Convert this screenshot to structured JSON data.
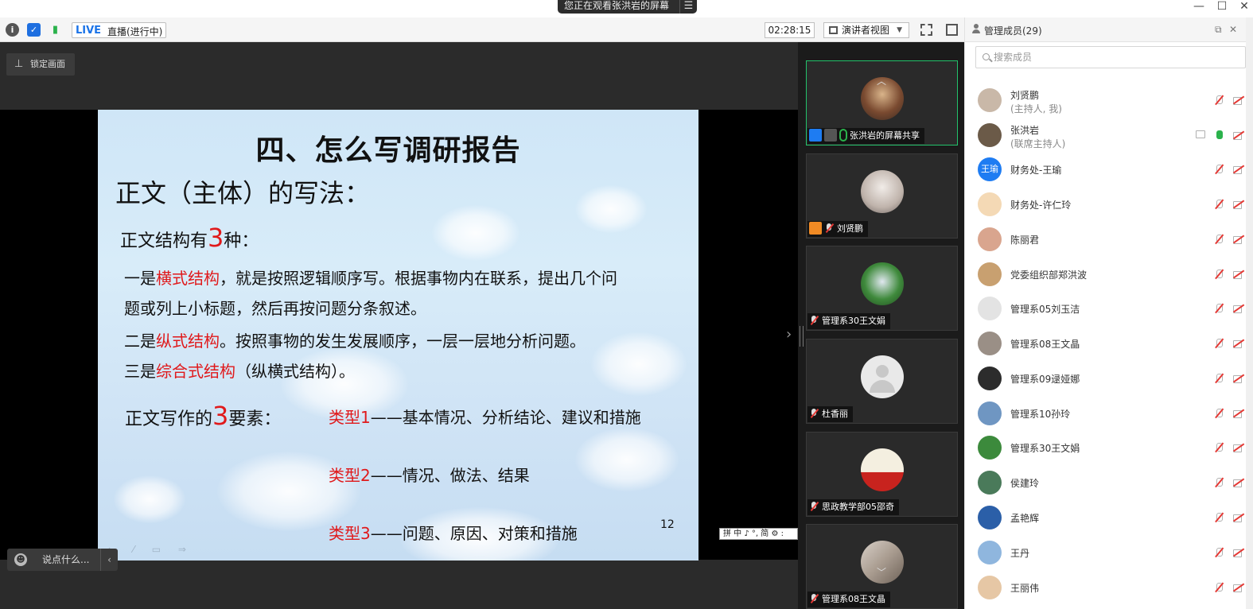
{
  "window": {
    "sharing_banner": "您正在观看张洪岩的屏幕",
    "menu_glyph": "☰",
    "minimize": "—",
    "maximize": "☐",
    "close": "✕"
  },
  "toolbar": {
    "live_label": "LIVE",
    "live_status": "直播(进行中)",
    "timer": "02:28:15",
    "view_mode": "演讲者视图",
    "info_icon": "info-icon",
    "shield_icon": "shield-icon",
    "signal_icon": "signal-icon"
  },
  "stage": {
    "lock_button": "锁定画面",
    "chat_placeholder": "说点什么...",
    "ime_text": "拼 中 ♪ °, 简 ⚙ :"
  },
  "slide": {
    "title": "四、怎么写调研报告",
    "heading": "正文（主体）的写法：",
    "structures_prefix": "正文结构有",
    "structures_num": "3",
    "structures_suffix": "种：",
    "line1_a": "一是",
    "line1_red": "横式结构",
    "line1_b": "，就是按照逻辑顺序写。根据事物内在联系，提出几个问",
    "line1_c": "题或列上小标题，然后再按问题分条叙述。",
    "line2_a": "二是",
    "line2_red": "纵式结构",
    "line2_b": "。按照事物的发生发展顺序，一层一层地分析问题。",
    "line3_a": "三是",
    "line3_red": "综合式结构",
    "line3_b": "（纵横式结构）。",
    "elements_prefix": "正文写作的",
    "elements_num": "3",
    "elements_suffix": "要素：",
    "types": [
      {
        "label": "类型1",
        "text": "——基本情况、分析结论、建议和措施"
      },
      {
        "label": "类型2",
        "text": "——情况、做法、结果"
      },
      {
        "label": "类型3",
        "text": "——问题、原因、对策和措施"
      }
    ],
    "page_number": "12"
  },
  "video_tiles": [
    {
      "caption": "张洪岩的屏幕共享",
      "active": true
    },
    {
      "caption": "刘贤鹏",
      "active": false
    },
    {
      "caption": "管理系30王文娟",
      "active": false
    },
    {
      "caption": "杜香丽",
      "active": false
    },
    {
      "caption": "思政教学部05邵奇",
      "active": false
    },
    {
      "caption": "管理系08王文晶",
      "active": false
    }
  ],
  "members_panel": {
    "title": "管理成员(29)",
    "search_placeholder": "搜索成员",
    "members": [
      {
        "name": "刘贤鹏",
        "sub": "(主持人, 我)",
        "avatar": "#c9b8a8"
      },
      {
        "name": "张洪岩",
        "sub": "(联席主持人)",
        "avatar": "#6b5a48",
        "mic_on": true
      },
      {
        "name": "财务处-王瑜",
        "sub": "",
        "avatar": "#1e7cf2",
        "initials": "王瑜"
      },
      {
        "name": "财务处-许仁玲",
        "sub": "",
        "avatar": "#f4d9b5"
      },
      {
        "name": "陈丽君",
        "sub": "",
        "avatar": "#d9a58e"
      },
      {
        "name": "党委组织部郑洪波",
        "sub": "",
        "avatar": "#c8a070"
      },
      {
        "name": "管理系05刘玉洁",
        "sub": "",
        "avatar": "#e3e3e3"
      },
      {
        "name": "管理系08王文晶",
        "sub": "",
        "avatar": "#9a8f86"
      },
      {
        "name": "管理系09逯娅娜",
        "sub": "",
        "avatar": "#2c2c2c"
      },
      {
        "name": "管理系10孙玲",
        "sub": "",
        "avatar": "#6f96c2"
      },
      {
        "name": "管理系30王文娟",
        "sub": "",
        "avatar": "#3c8a3c"
      },
      {
        "name": "侯建玲",
        "sub": "",
        "avatar": "#4a7a5a"
      },
      {
        "name": "孟艳辉",
        "sub": "",
        "avatar": "#2b5fa8"
      },
      {
        "name": "王丹",
        "sub": "",
        "avatar": "#8fb6de"
      },
      {
        "name": "王丽伟",
        "sub": "",
        "avatar": "#e6c7a5"
      }
    ]
  }
}
